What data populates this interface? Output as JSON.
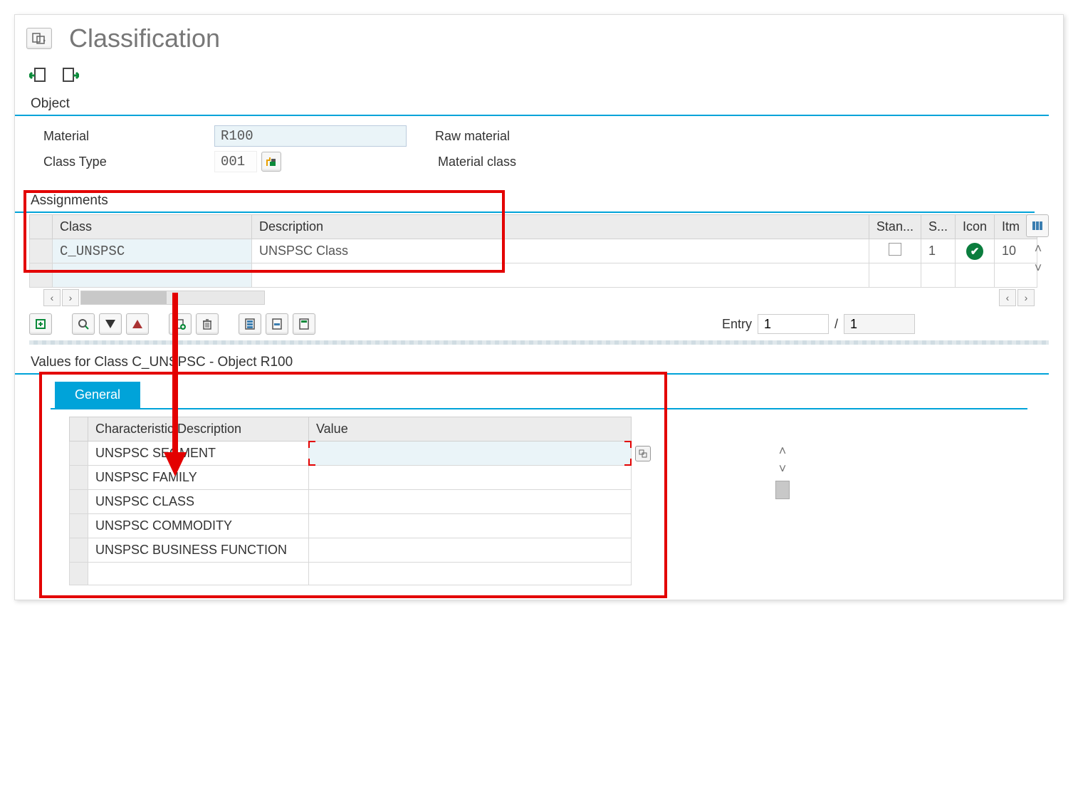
{
  "header": {
    "title": "Classification"
  },
  "object": {
    "section_label": "Object",
    "material_label": "Material",
    "material_value": "R100",
    "material_desc": "Raw material",
    "classtype_label": "Class Type",
    "classtype_value": "001",
    "classtype_desc": "Material class"
  },
  "assignments": {
    "section_label": "Assignments",
    "columns": {
      "class": "Class",
      "description": "Description",
      "stan": "Stan...",
      "s": "S...",
      "icon": "Icon",
      "itm": "Itm"
    },
    "rows": [
      {
        "class": "C_UNSPSC",
        "description": "UNSPSC Class",
        "stan": "",
        "s": "1",
        "icon": "check",
        "itm": "10"
      }
    ]
  },
  "entry": {
    "label": "Entry",
    "current": "1",
    "sep": "/",
    "total": "1"
  },
  "values": {
    "header": "Values for Class C_UNSPSC - Object R100",
    "tab": "General",
    "columns": {
      "char": "Characteristic Description",
      "value": "Value"
    },
    "rows": [
      {
        "char": "UNSPSC SEGMENT",
        "value": "",
        "active": true
      },
      {
        "char": "UNSPSC FAMILY",
        "value": ""
      },
      {
        "char": "UNSPSC CLASS",
        "value": ""
      },
      {
        "char": "UNSPSC COMMODITY",
        "value": ""
      },
      {
        "char": "UNSPSC BUSINESS FUNCTION",
        "value": ""
      }
    ]
  }
}
